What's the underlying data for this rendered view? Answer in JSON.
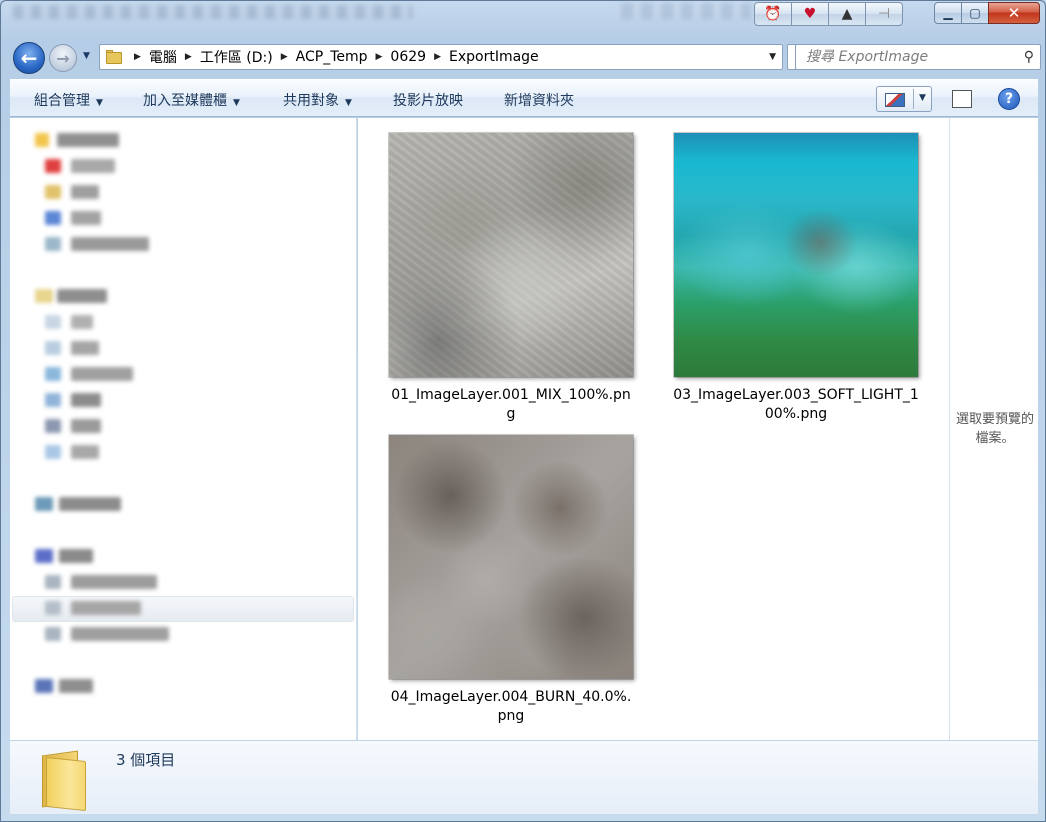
{
  "address": {
    "crumbs": [
      "電腦",
      "工作區 (D:)",
      "ACP_Temp",
      "0629",
      "ExportImage"
    ]
  },
  "search": {
    "placeholder": "搜尋 ExportImage"
  },
  "toolbar": {
    "organize": "組合管理",
    "add_to_library": "加入至媒體櫃",
    "share_with": "共用對象",
    "slideshow": "投影片放映",
    "new_folder": "新增資料夾"
  },
  "files": [
    {
      "name": "01_ImageLayer.001_MIX_100%.png"
    },
    {
      "name": "03_ImageLayer.003_SOFT_LIGHT_100%.png"
    },
    {
      "name": "04_ImageLayer.004_BURN_40.0%.png"
    }
  ],
  "preview": {
    "message": "選取要預覽的檔案。"
  },
  "status": {
    "item_count": "3 個項目"
  },
  "colors": {
    "accent": "#1e395b",
    "selection": "#e6ebf1",
    "close": "#c2341c"
  },
  "icons": [
    "back-arrow-icon",
    "forward-arrow-icon",
    "folder-icon",
    "refresh-icon",
    "search-icon",
    "view-icon",
    "preview-pane-icon",
    "help-icon"
  ]
}
